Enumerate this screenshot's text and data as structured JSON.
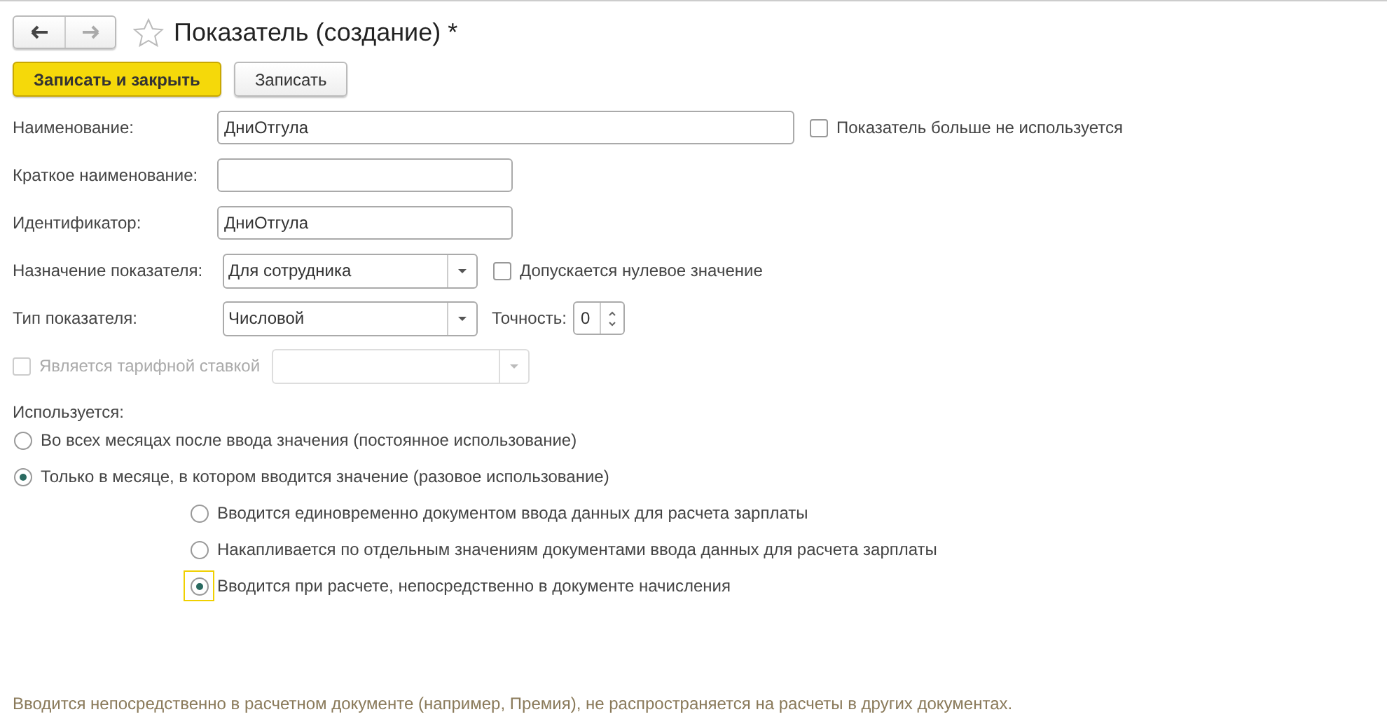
{
  "window": {
    "title": "Показатель (создание) *",
    "favorite": false
  },
  "buttons": [
    {
      "label": "Записать и закрыть",
      "kind": "primary"
    },
    {
      "label": "Записать",
      "kind": "default"
    }
  ],
  "name": {
    "label": "Наименование:",
    "value": "ДниОтгула"
  },
  "not_used": {
    "label": "Показатель больше не используется",
    "checked": false
  },
  "short_name": {
    "label": "Краткое наименование:"
  },
  "identifier": {
    "label": "Идентификатор:",
    "value": "ДниОтгула"
  },
  "purpose": {
    "label": "Назначение показателя:",
    "value": "Для сотрудника"
  },
  "zero_allowed": {
    "label": "Допускается нулевое значение",
    "checked": false
  },
  "type": {
    "label": "Тип показателя:",
    "value": "Числовой"
  },
  "precision": {
    "label": "Точность:",
    "value": "0"
  },
  "tariff": {
    "label": "Является тарифной ставкой",
    "checked": false,
    "disabled": true
  },
  "usage": {
    "label": "Используется:",
    "options": [
      {
        "label": "Во всех месяцах после ввода значения (постоянное использование)",
        "selected": false
      },
      {
        "label": "Только в месяце, в котором вводится значение (разовое использование)",
        "selected": true,
        "children": [
          {
            "label": "Вводится единовременно документом ввода данных для расчета зарплаты",
            "selected": false,
            "focused": false
          },
          {
            "label": "Накапливается по отдельным значениям документами ввода данных для расчета зарплаты",
            "selected": false,
            "focused": false
          },
          {
            "label": "Вводится при расчете, непосредственно в документе начисления",
            "selected": true,
            "focused": true
          }
        ]
      }
    ]
  },
  "hint": "Вводится непосредственно в расчетном документе (например, Премия), не распространяется на расчеты в других документах."
}
